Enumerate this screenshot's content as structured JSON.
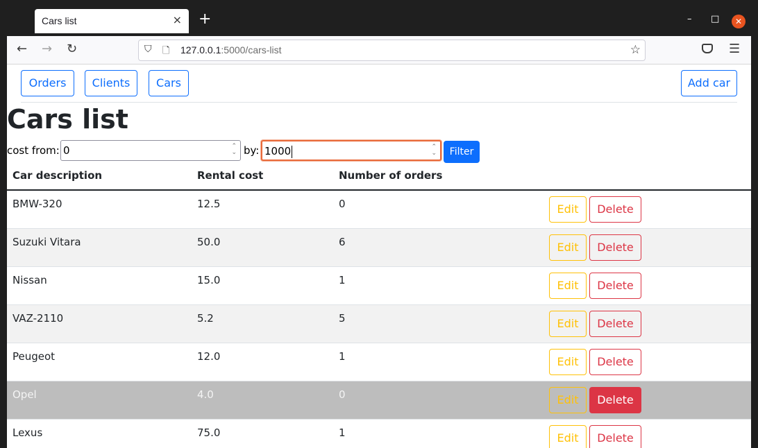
{
  "browser": {
    "tab_title": "Cars list",
    "tab_close": "×",
    "new_tab": "+",
    "url_host": "127.0.0.1",
    "url_path": ":5000/cars-list",
    "win_min": "–",
    "win_max": "□",
    "win_close": "✕"
  },
  "nav": {
    "orders": "Orders",
    "clients": "Clients",
    "cars": "Cars",
    "add_car": "Add car"
  },
  "page_title": "Cars list",
  "filter": {
    "from_label": "cost from:",
    "from_value": "0",
    "by_label": "by:",
    "by_value": "1000",
    "button": "Filter"
  },
  "table": {
    "headers": [
      "Car description",
      "Rental cost",
      "Number of orders"
    ],
    "edit_label": "Edit",
    "delete_label": "Delete",
    "rows": [
      {
        "description": "BMW-320",
        "cost": "12.5",
        "orders": "0"
      },
      {
        "description": "Suzuki Vitara",
        "cost": "50.0",
        "orders": "6"
      },
      {
        "description": "Nissan",
        "cost": "15.0",
        "orders": "1"
      },
      {
        "description": "VAZ-2110",
        "cost": "5.2",
        "orders": "5"
      },
      {
        "description": "Peugeot",
        "cost": "12.0",
        "orders": "1"
      },
      {
        "description": "Opel",
        "cost": "4.0",
        "orders": "0"
      },
      {
        "description": "Lexus",
        "cost": "75.0",
        "orders": "1"
      }
    ]
  },
  "colors": {
    "primary": "#0d6efd",
    "warning": "#ffc107",
    "danger": "#dc3545",
    "hovered_row": "#bdbdbd"
  }
}
